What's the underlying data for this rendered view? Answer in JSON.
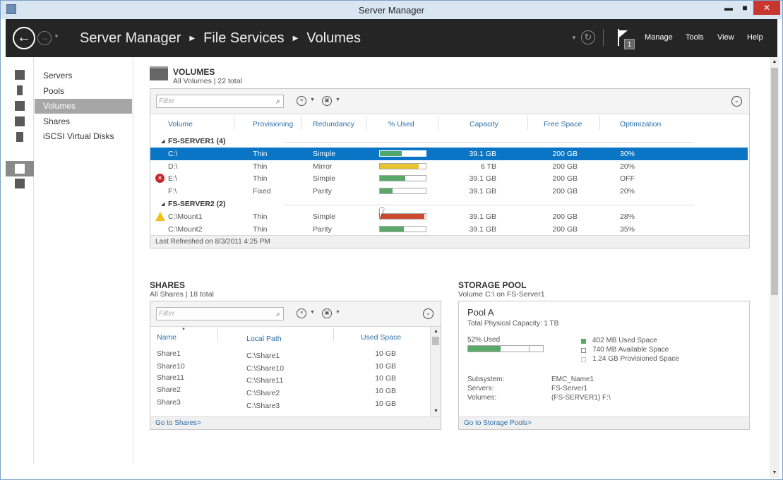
{
  "window": {
    "title": "Server Manager",
    "controls": {
      "minimize": "▬",
      "maximize": "■",
      "close": "✕"
    }
  },
  "header": {
    "breadcrumb": [
      "Server Manager",
      "File Services",
      "Volumes"
    ],
    "notification_count": "1",
    "menu": [
      "Manage",
      "Tools",
      "View",
      "Help"
    ]
  },
  "sidebar_icons": [
    "dashboard-icon",
    "local-server-icon",
    "all-servers-icon",
    "ad-icon",
    "dns-icon",
    "file-services-icon",
    "tools-icon"
  ],
  "nav": {
    "items": [
      "Servers",
      "Pools",
      "Volumes",
      "Shares",
      "iSCSI Virtual Disks"
    ],
    "selected": "Volumes"
  },
  "volumes": {
    "title": "VOLUMES",
    "subtitle": "All Volumes | 22 total",
    "filter_placeholder": "Filter",
    "columns": [
      "Volume",
      "Provisioning",
      "Redundancy",
      "% Used",
      "Capacity",
      "Free Space",
      "Optimization"
    ],
    "groups": [
      {
        "label": "FS-SERVER1 (4)"
      },
      {
        "label": "FS-SERVER2 (2)"
      }
    ],
    "rows": [
      {
        "volume": "C:\\",
        "provisioning": "Thin",
        "redundancy": "Simple",
        "used": 0.47,
        "bar_color": "#4ea86b",
        "capacity": "39.1 GB",
        "free": "200 GB",
        "optimization": "30%",
        "status": "",
        "selected": true
      },
      {
        "volume": "D:\\",
        "provisioning": "Thin",
        "redundancy": "Mirror",
        "used": 0.85,
        "bar_color": "#e8c52e",
        "capacity": "6 TB",
        "free": "200 GB",
        "optimization": "20%",
        "status": ""
      },
      {
        "volume": "E:\\",
        "provisioning": "Thin",
        "redundancy": "Simple",
        "used": 0.55,
        "bar_color": "#5aa86a",
        "capacity": "39.1 GB",
        "free": "200 GB",
        "optimization": "OFF",
        "status": "error"
      },
      {
        "volume": "F:\\",
        "provisioning": "Fixed",
        "redundancy": "Parity",
        "used": 0.28,
        "bar_color": "#5aa86a",
        "capacity": "39.1 GB",
        "free": "200 GB",
        "optimization": "20%",
        "status": ""
      },
      {
        "volume": "C:\\Mount1",
        "provisioning": "Thin",
        "redundancy": "Simple",
        "used": 0.97,
        "bar_color": "#cc4a2e",
        "capacity": "39.1 GB",
        "free": "200 GB",
        "optimization": "28%",
        "status": "warning"
      },
      {
        "volume": "C:\\Mount2",
        "provisioning": "Thin",
        "redundancy": "Parity",
        "used": 0.52,
        "bar_color": "#5aa86a",
        "capacity": "39.1 GB",
        "free": "200 GB",
        "optimization": "35%",
        "status": ""
      }
    ],
    "footer": "Last Refreshed on 8/3/2011 4:25 PM"
  },
  "shares": {
    "title": "SHARES",
    "subtitle": "All Shares | 18 total",
    "filter_placeholder": "Filter",
    "columns": [
      "Name",
      "Local Path",
      "Used Space"
    ],
    "rows": [
      {
        "name": "Share1",
        "path": "C:\\Share1",
        "used": "10 GB"
      },
      {
        "name": "Share10",
        "path": "C:\\Share10",
        "used": "10 GB"
      },
      {
        "name": "Share11",
        "path": "C:\\Share11",
        "used": "10 GB"
      },
      {
        "name": "Share2",
        "path": "C:\\Share2",
        "used": "10 GB"
      },
      {
        "name": "Share3",
        "path": "C:\\Share3",
        "used": "10 GB"
      }
    ],
    "footer_link": "Go to Shares>"
  },
  "storage_pool": {
    "title": "STORAGE POOL",
    "subtitle": "Volume C:\\ on FS-Server1",
    "pool_name": "Pool A",
    "capacity_label": "Total Physical Capacity: 1 TB",
    "used_label": "52% Used",
    "used_fraction": 0.52,
    "legend": [
      "402 MB Used Space",
      "740 MB Available Space",
      "1.24 GB Provisioned Space"
    ],
    "details": [
      {
        "key": "Subsystem:",
        "value": "EMC_Name1"
      },
      {
        "key": "Servers:",
        "value": "FS-Server1"
      },
      {
        "key": "Volumes:",
        "value": "(FS-SERVER1) F:\\"
      }
    ],
    "footer_link": "Go to Storage Pools>"
  },
  "colors": {
    "accent": "#0a74c5",
    "header_bg": "#252526",
    "link": "#2c6fa8",
    "used_green": "#5aa86a"
  }
}
